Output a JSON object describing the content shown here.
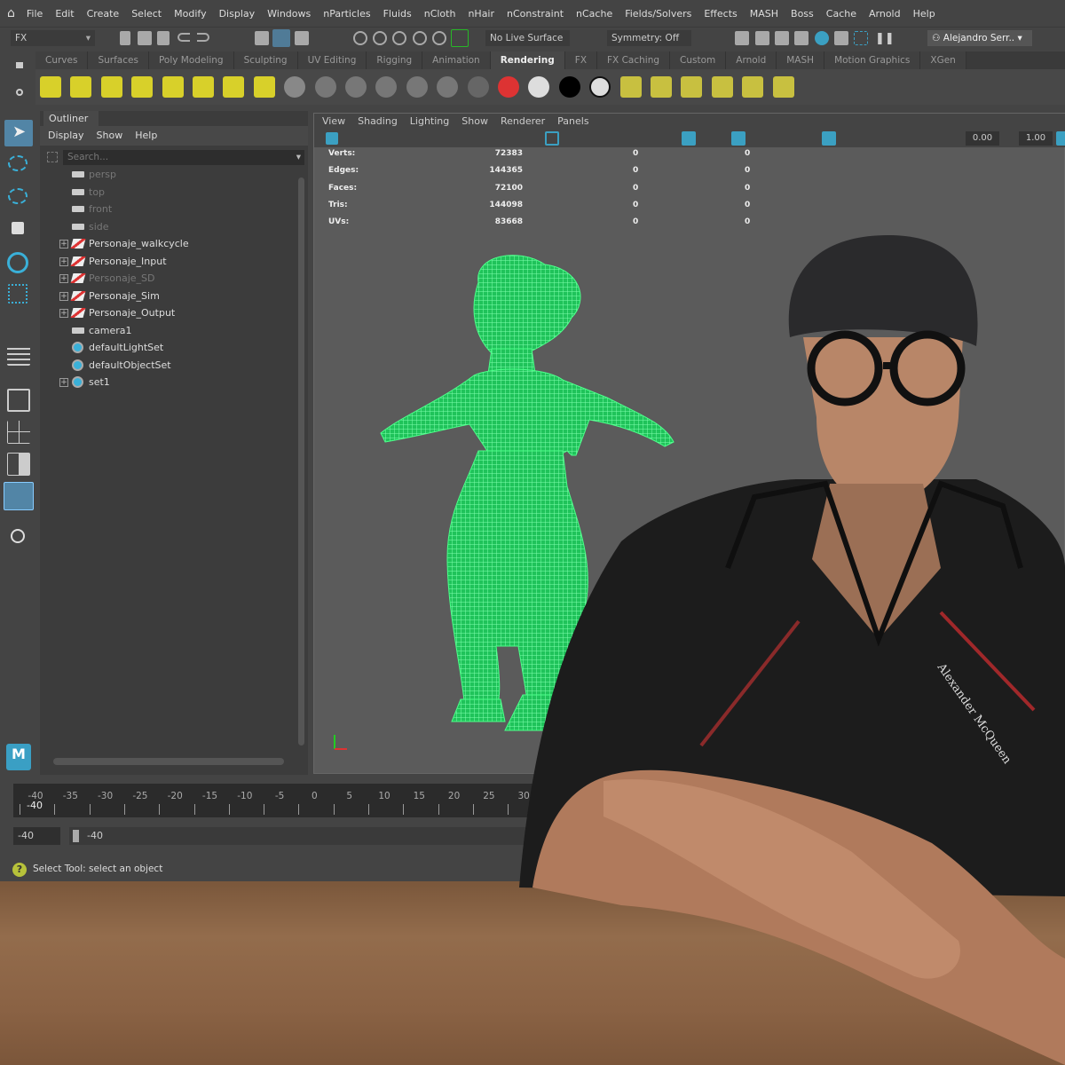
{
  "menubar": {
    "items": [
      "File",
      "Edit",
      "Create",
      "Select",
      "Modify",
      "Display",
      "Windows",
      "nParticles",
      "Fluids",
      "nCloth",
      "nHair",
      "nConstraint",
      "nCache",
      "Fields/Solvers",
      "Effects",
      "MASH",
      "Boss",
      "Cache",
      "Arnold",
      "Help"
    ]
  },
  "toolbar": {
    "menu_set": "FX",
    "live_surface": "No Live Surface",
    "symmetry": "Symmetry: Off",
    "user": "Alejandro Serr.."
  },
  "shelf": {
    "tabs": [
      "Curves",
      "Surfaces",
      "Poly Modeling",
      "Sculpting",
      "UV Editing",
      "Rigging",
      "Animation",
      "Rendering",
      "FX",
      "FX Caching",
      "Custom",
      "Arnold",
      "MASH",
      "Motion Graphics",
      "XGen"
    ],
    "active": "Rendering"
  },
  "outliner": {
    "title": "Outliner",
    "menu": [
      "Display",
      "Show",
      "Help"
    ],
    "search_placeholder": "Search...",
    "items": [
      {
        "label": "persp",
        "type": "camera",
        "dim": true,
        "expand": false
      },
      {
        "label": "top",
        "type": "camera",
        "dim": true,
        "expand": false
      },
      {
        "label": "front",
        "type": "camera",
        "dim": true,
        "expand": false
      },
      {
        "label": "side",
        "type": "camera",
        "dim": true,
        "expand": false
      },
      {
        "label": "Personaje_walkcycle",
        "type": "group",
        "dim": false,
        "expand": true
      },
      {
        "label": "Personaje_Input",
        "type": "group",
        "dim": false,
        "expand": true
      },
      {
        "label": "Personaje_SD",
        "type": "group",
        "dim": true,
        "expand": true
      },
      {
        "label": "Personaje_Sim",
        "type": "group",
        "dim": false,
        "expand": true
      },
      {
        "label": "Personaje_Output",
        "type": "group",
        "dim": false,
        "expand": true
      },
      {
        "label": "camera1",
        "type": "camera",
        "dim": false,
        "expand": false
      },
      {
        "label": "defaultLightSet",
        "type": "set",
        "dim": false,
        "expand": false
      },
      {
        "label": "defaultObjectSet",
        "type": "set",
        "dim": false,
        "expand": false
      },
      {
        "label": "set1",
        "type": "set",
        "dim": false,
        "expand": true
      }
    ]
  },
  "viewport": {
    "menu": [
      "View",
      "Shading",
      "Lighting",
      "Show",
      "Renderer",
      "Panels"
    ],
    "exposure": "0.00",
    "gamma": "1.00",
    "stats": [
      {
        "label": "Verts:",
        "v1": "72383",
        "v2": "0",
        "v3": "0"
      },
      {
        "label": "Edges:",
        "v1": "144365",
        "v2": "0",
        "v3": "0"
      },
      {
        "label": "Faces:",
        "v1": "72100",
        "v2": "0",
        "v3": "0"
      },
      {
        "label": "Tris:",
        "v1": "144098",
        "v2": "0",
        "v3": "0"
      },
      {
        "label": "UVs:",
        "v1": "83668",
        "v2": "0",
        "v3": "0"
      }
    ]
  },
  "timeline": {
    "ticks": [
      "-40",
      "-35",
      "-30",
      "-25",
      "-20",
      "-15",
      "-10",
      "-5",
      "0",
      "5",
      "10",
      "15",
      "20",
      "25",
      "30"
    ],
    "current": "-40"
  },
  "range": {
    "start": "-40",
    "slider_start": "-40"
  },
  "status": {
    "message": "Select Tool: select an object"
  },
  "logo": {
    "letter": "M"
  },
  "shirt_text": "Alexander McQueen",
  "colors": {
    "accent": "#5285a6",
    "wire": "#2ee870",
    "bg": "#444444"
  }
}
